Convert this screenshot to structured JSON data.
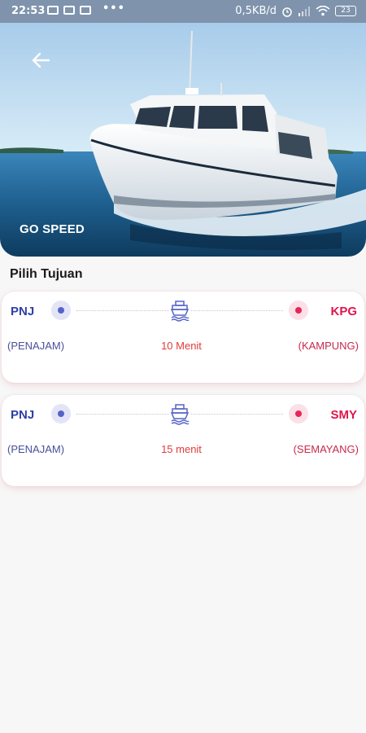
{
  "status_bar": {
    "time": "22:53",
    "dots": "•••",
    "network_speed": "0,5KB/d",
    "battery": "23"
  },
  "hero": {
    "label": "GO SPEED",
    "back_icon": "arrow-left-icon"
  },
  "section_title": "Pilih Tujuan",
  "routes": [
    {
      "origin_code": "PNJ",
      "origin_name": "(PENAJAM)",
      "duration": "10 Menit",
      "dest_code": "KPG",
      "dest_name": "(KAMPUNG)"
    },
    {
      "origin_code": "PNJ",
      "origin_name": "(PENAJAM)",
      "duration": "15 menit",
      "dest_code": "SMY",
      "dest_name": "(SEMAYANG)"
    }
  ],
  "colors": {
    "origin_accent": "#2e3fa6",
    "dest_accent": "#e0144c",
    "duration_text": "#e23b3b"
  },
  "icons": {
    "ship": "ship-icon",
    "origin_marker": "origin-dot-icon",
    "dest_marker": "destination-dot-icon"
  }
}
